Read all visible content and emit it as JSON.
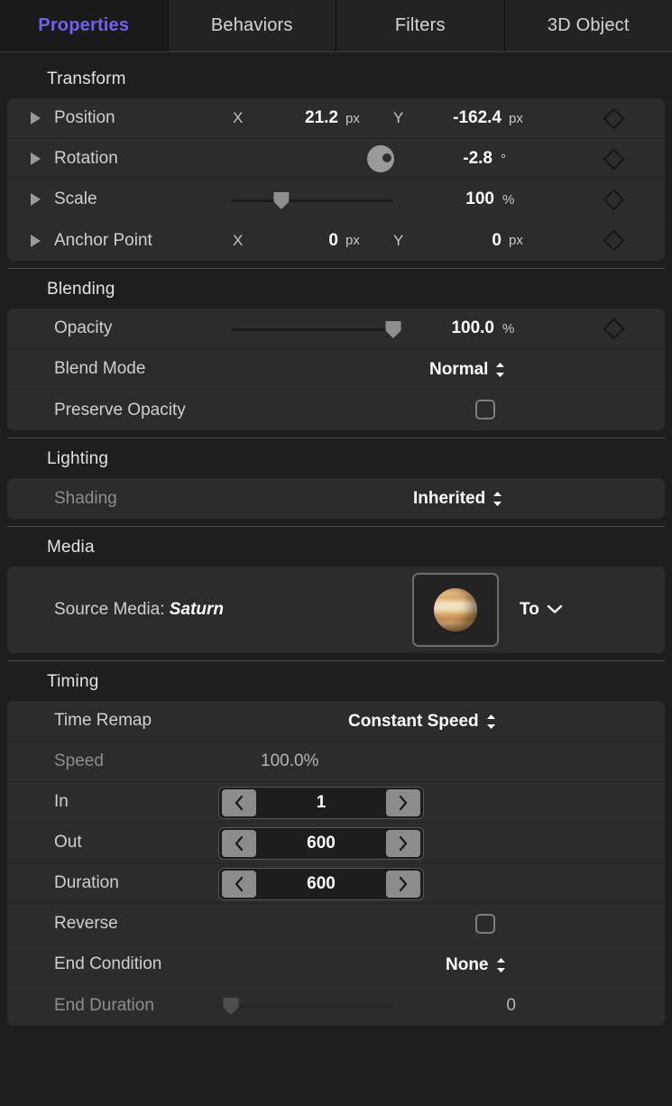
{
  "tabs": [
    {
      "label": "Properties",
      "active": true
    },
    {
      "label": "Behaviors",
      "active": false
    },
    {
      "label": "Filters",
      "active": false
    },
    {
      "label": "3D Object",
      "active": false
    }
  ],
  "sections": {
    "transform": {
      "title": "Transform",
      "position": {
        "label": "Position",
        "x_axis": "X",
        "x_value": "21.2",
        "x_unit": "px",
        "y_axis": "Y",
        "y_value": "-162.4",
        "y_unit": "px"
      },
      "rotation": {
        "label": "Rotation",
        "value": "-2.8",
        "unit": "°"
      },
      "scale": {
        "label": "Scale",
        "value": "100",
        "unit": "%",
        "slider_percent": 31
      },
      "anchor_point": {
        "label": "Anchor Point",
        "x_axis": "X",
        "x_value": "0",
        "x_unit": "px",
        "y_axis": "Y",
        "y_value": "0",
        "y_unit": "px"
      }
    },
    "blending": {
      "title": "Blending",
      "opacity": {
        "label": "Opacity",
        "value": "100.0",
        "unit": "%",
        "slider_percent": 100
      },
      "blend_mode": {
        "label": "Blend Mode",
        "value": "Normal"
      },
      "preserve_opacity": {
        "label": "Preserve Opacity",
        "checked": false
      }
    },
    "lighting": {
      "title": "Lighting",
      "shading": {
        "label": "Shading",
        "value": "Inherited"
      }
    },
    "media": {
      "title": "Media",
      "source_label": "Source Media:",
      "source_name": "Saturn",
      "thumbnail_icon": "saturn-planet-thumbnail",
      "to_menu_label": "To"
    },
    "timing": {
      "title": "Timing",
      "time_remap": {
        "label": "Time Remap",
        "value": "Constant Speed"
      },
      "speed": {
        "label": "Speed",
        "value": "100.0%"
      },
      "in": {
        "label": "In",
        "value": "1"
      },
      "out": {
        "label": "Out",
        "value": "600"
      },
      "duration": {
        "label": "Duration",
        "value": "600"
      },
      "reverse": {
        "label": "Reverse",
        "checked": false
      },
      "end_condition": {
        "label": "End Condition",
        "value": "None"
      },
      "end_duration": {
        "label": "End Duration",
        "value": "0",
        "slider_percent": 0
      }
    }
  },
  "icons": {
    "disclosure_triangle": "disclosure-triangle-icon",
    "keyframe_diamond": "keyframe-diamond-icon",
    "popup_updown": "popup-updown-arrows-icon",
    "chevron_down": "chevron-down-icon",
    "stepper_left": "‹",
    "stepper_right": "›"
  },
  "colors": {
    "accent": "#6e62f0",
    "panel_bg": "#1e1e1e",
    "row_bg": "#2c2c2c",
    "text": "#cfcfcf"
  }
}
